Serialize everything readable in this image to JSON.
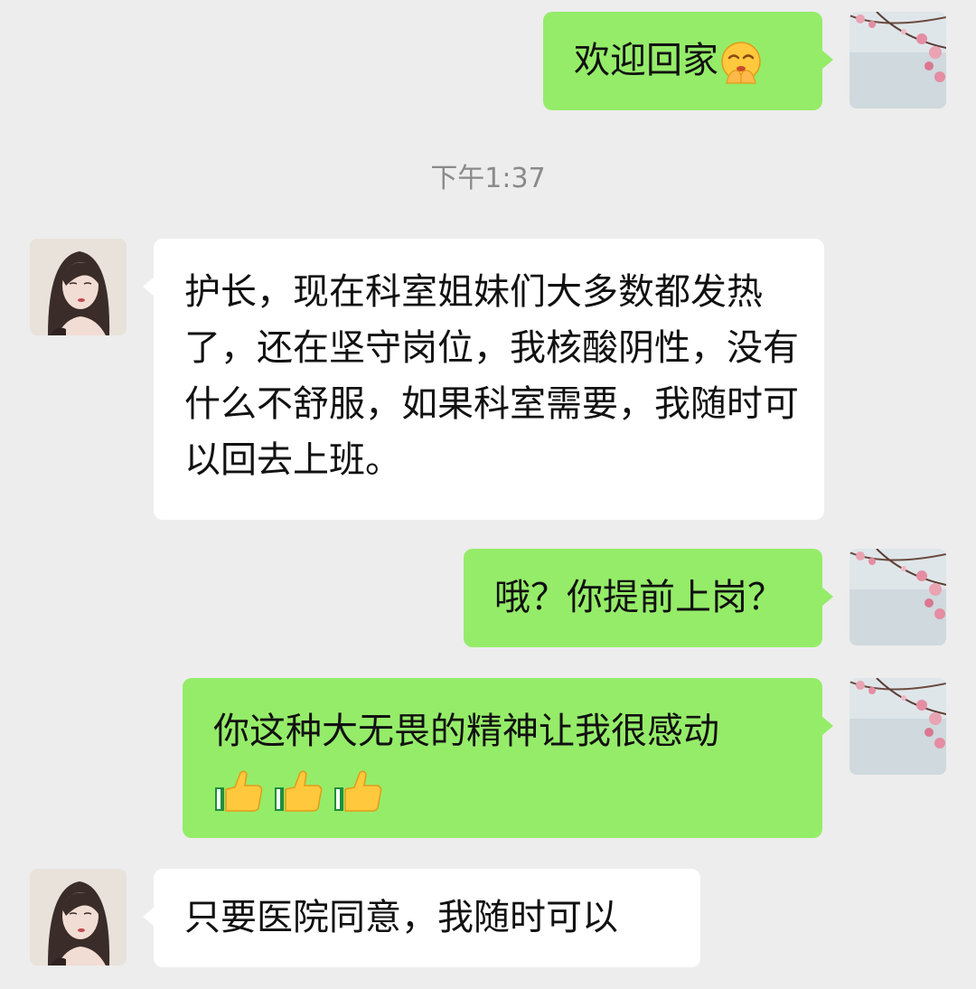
{
  "chat": {
    "timestamp": "下午1:37",
    "messages": [
      {
        "sender": "me",
        "text": "欢迎回家",
        "emoji": "shushing-face-icon"
      },
      {
        "sender": "other",
        "text": "护长，现在科室姐妹们大多数都发热了，还在坚守岗位，我核酸阴性，没有什么不舒服，如果科室需要，我随时可以回去上班。"
      },
      {
        "sender": "me",
        "text": "哦？你提前上岗？"
      },
      {
        "sender": "me",
        "text": "你这种大无畏的精神让我很感动",
        "emoji": "thumbs-up-icon x3"
      },
      {
        "sender": "other",
        "text": "只要医院同意，我随时可以"
      }
    ]
  },
  "colors": {
    "background": "#ededed",
    "my_bubble": "#95ec69",
    "other_bubble": "#ffffff",
    "timestamp_text": "#8a8a8a"
  }
}
